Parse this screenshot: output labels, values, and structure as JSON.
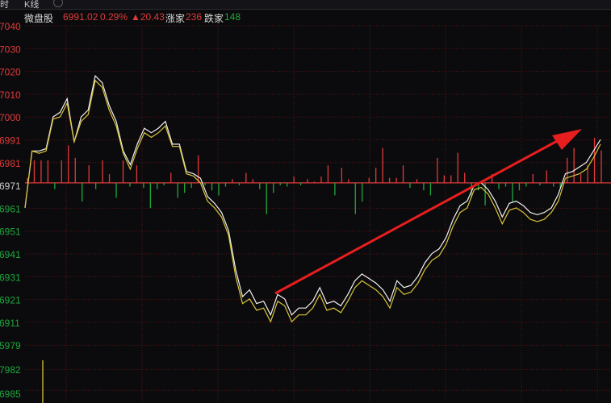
{
  "tabs": [
    {
      "label": "时"
    },
    {
      "label": "K线"
    }
  ],
  "header": {
    "name": "微盘股",
    "price": "6991.02",
    "change_pct": "0.29%",
    "change_abs": "▲20.43",
    "up_label": "涨家",
    "up_count": "236",
    "down_label": "跌家",
    "down_count": "148"
  },
  "colors": {
    "background": "#0b0b0d",
    "grid": "#5a1416",
    "up": "#e03a3a",
    "down": "#1ea83c",
    "price_line": "#f2f2f2",
    "avg_line": "#d8c43a",
    "arrow": "#e81e1e",
    "baseline": "#e23b3b"
  },
  "chart_data": {
    "type": "line",
    "title": "",
    "xlabel": "",
    "ylabel": "",
    "baseline": 6971,
    "ylim": [
      6903,
      7040
    ],
    "price_tick_labels": [
      "7040",
      "7030",
      "7020",
      "7010",
      "7000",
      "6991",
      "6981",
      "6971",
      "6961",
      "6951",
      "6941",
      "6931",
      "6921",
      "6911"
    ],
    "volume_tick_labels": [
      "5979",
      "7982",
      "6985"
    ],
    "series": [
      {
        "values": [
          6960,
          6985,
          6985,
          6986,
          7000,
          7002,
          7008,
          6989,
          7000,
          7003,
          7018,
          7015,
          7005,
          6998,
          6985,
          6979,
          6988,
          6995,
          6993,
          6995,
          6998,
          6988,
          6988,
          6976,
          6975,
          6973,
          6965,
          6962,
          6958,
          6950,
          6933,
          6921,
          6924,
          6918,
          6919,
          6913,
          6922,
          6920,
          6913,
          6916,
          6916,
          6919,
          6925,
          6918,
          6919,
          6917,
          6922,
          6928,
          6931,
          6929,
          6927,
          6924,
          6919,
          6928,
          6925,
          6926,
          6930,
          6936,
          6940,
          6942,
          6947,
          6955,
          6961,
          6963,
          6970,
          6971,
          6968,
          6963,
          6956,
          6962,
          6963,
          6961,
          6958,
          6957,
          6958,
          6960,
          6966,
          6975,
          6976,
          6978,
          6980,
          6985,
          6990
        ]
      },
      {
        "values": [
          6960,
          6985,
          6984,
          6985,
          6999,
          7000,
          7006,
          6989,
          6998,
          7001,
          7016,
          7013,
          7003,
          6996,
          6984,
          6977,
          6986,
          6993,
          6991,
          6993,
          6996,
          6987,
          6987,
          6975,
          6974,
          6971,
          6963,
          6960,
          6956,
          6948,
          6930,
          6918,
          6920,
          6915,
          6916,
          6910,
          6919,
          6917,
          6910,
          6913,
          6913,
          6916,
          6922,
          6915,
          6916,
          6914,
          6919,
          6925,
          6928,
          6926,
          6924,
          6921,
          6916,
          6925,
          6922,
          6923,
          6927,
          6933,
          6937,
          6939,
          6944,
          6952,
          6958,
          6960,
          6968,
          6969,
          6966,
          6960,
          6953,
          6959,
          6960,
          6958,
          6955,
          6954,
          6955,
          6958,
          6963,
          6973,
          6974,
          6975,
          6977,
          6982,
          6988
        ]
      }
    ],
    "volume_bars": [
      4,
      18,
      18,
      18,
      -5,
      18,
      30,
      20,
      -15,
      14,
      -5,
      18,
      7,
      -12,
      18,
      -3,
      14,
      -4,
      -20,
      -5,
      -2,
      8,
      -12,
      -8,
      -4,
      22,
      -2,
      -6,
      -10,
      -3,
      3,
      -2,
      8,
      3,
      -5,
      -25,
      -8,
      -2,
      -3,
      5,
      -2,
      3,
      1,
      5,
      14,
      -10,
      12,
      3,
      -25,
      -15,
      4,
      12,
      28,
      4,
      4,
      14,
      -4,
      3,
      -6,
      -10,
      20,
      6,
      6,
      24,
      8,
      -12,
      -6,
      -18,
      7,
      -5,
      -3,
      -15,
      -6,
      -3,
      7,
      -2,
      10,
      -3,
      -4,
      20,
      28,
      7,
      14,
      36,
      26
    ]
  }
}
